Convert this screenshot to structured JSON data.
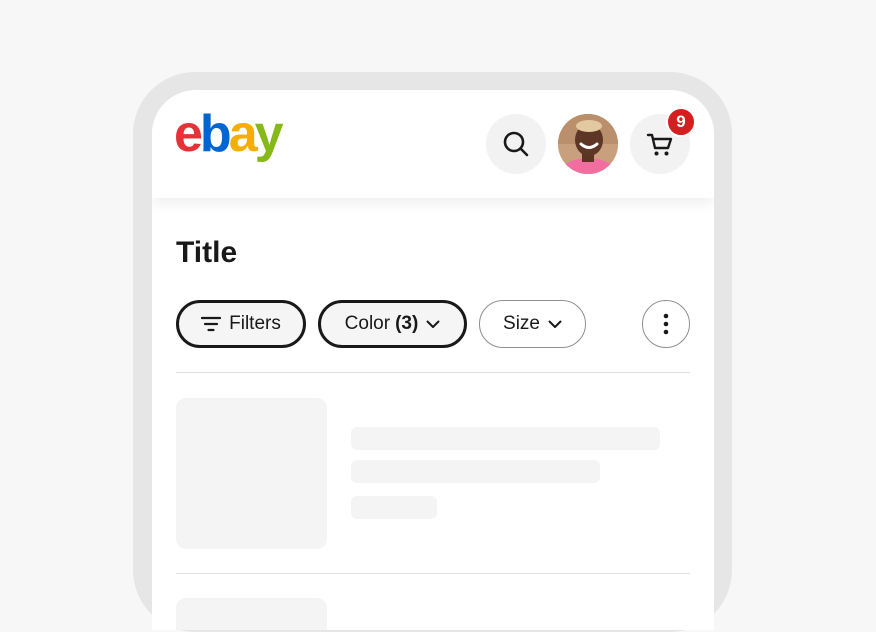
{
  "header": {
    "logo_letters": [
      {
        "char": "e",
        "color": "#e53238"
      },
      {
        "char": "b",
        "color": "#0064d2"
      },
      {
        "char": "a",
        "color": "#f5af02"
      },
      {
        "char": "y",
        "color": "#86b817"
      }
    ],
    "icons": {
      "search": "search-icon",
      "avatar": "user-avatar",
      "cart": "cart-icon"
    },
    "cart_count": "9"
  },
  "page": {
    "title": "Title"
  },
  "filters": {
    "filters_label": "Filters",
    "color_label": "Color",
    "color_count": "(3)",
    "size_label": "Size"
  },
  "colors": {
    "badge": "#d31f1f",
    "text": "#191919",
    "skeleton": "#f4f4f4"
  }
}
